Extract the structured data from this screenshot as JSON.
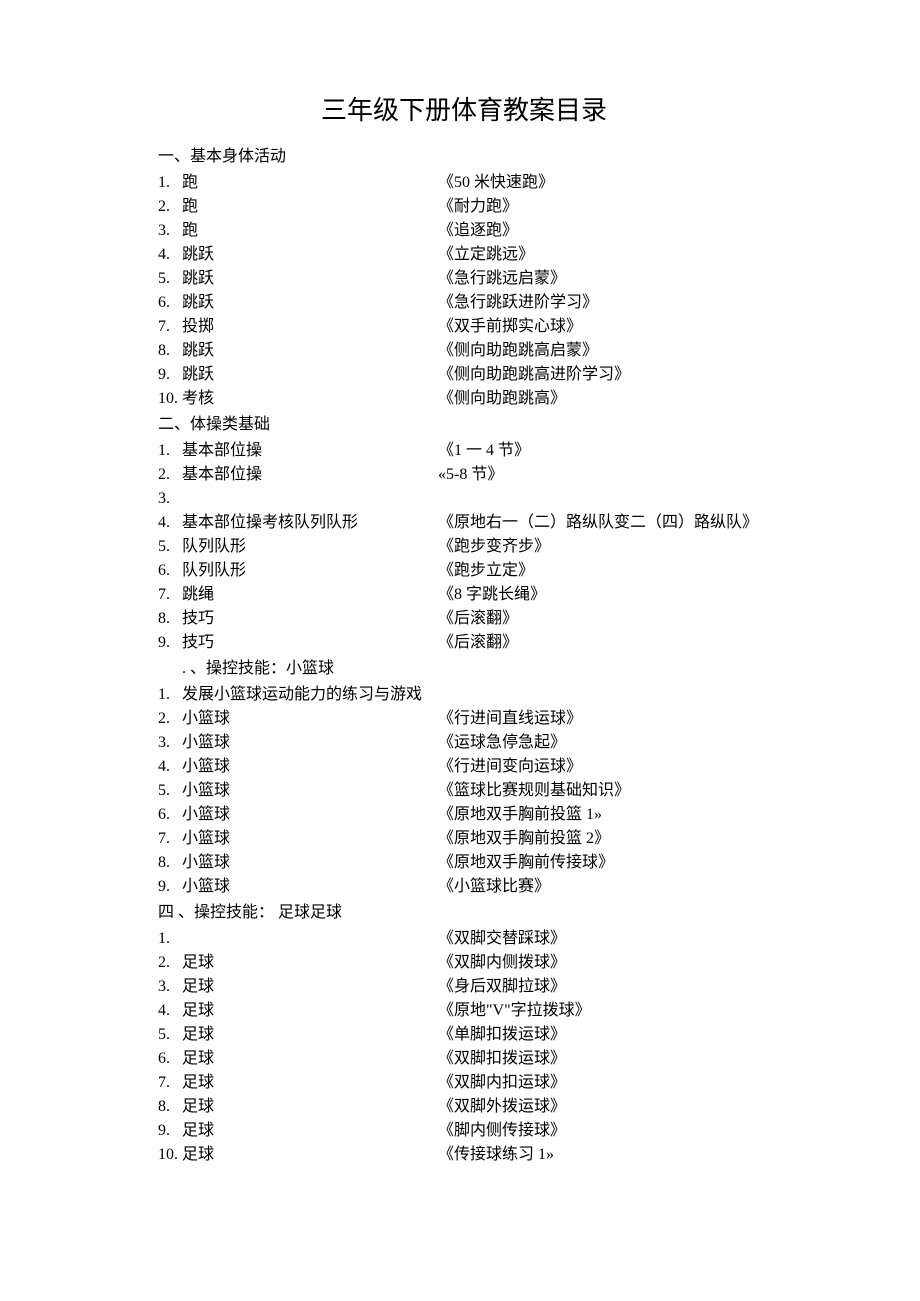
{
  "title": "三年级下册体育教案目录",
  "sections": [
    {
      "heading": "一、基本身体活动",
      "items": [
        {
          "num": "1.",
          "label": "跑",
          "desc": "《50 米快速跑》"
        },
        {
          "num": "2.",
          "label": "跑",
          "desc": "《耐力跑》"
        },
        {
          "num": "3.",
          "label": "跑",
          "desc": "《追逐跑》"
        },
        {
          "num": "4.",
          "label": "跳跃",
          "desc": "《立定跳远》"
        },
        {
          "num": "5.",
          "label": "跳跃",
          "desc": "《急行跳远启蒙》"
        },
        {
          "num": "6.",
          "label": "跳跃",
          "desc": "《急行跳跃进阶学习》"
        },
        {
          "num": "7.",
          "label": "投掷",
          "desc": "《双手前掷实心球》"
        },
        {
          "num": "8.",
          "label": "跳跃",
          "desc": "《侧向助跑跳高启蒙》"
        },
        {
          "num": "9.",
          "label": "跳跃",
          "desc": "《侧向助跑跳高进阶学习》"
        },
        {
          "num": "10.",
          "label": "考核",
          "desc": "《侧向助跑跳高》"
        }
      ]
    },
    {
      "heading": "二、体操类基础",
      "items": [
        {
          "num": "1.",
          "label": "基本部位操",
          "desc": "《1 一 4 节》"
        },
        {
          "num": "2.",
          "label": "基本部位操",
          "desc": "«5-8 节》"
        },
        {
          "num": "3.",
          "label": "",
          "desc": ""
        },
        {
          "num": "4.",
          "label": "基本部位操考核队列队形",
          "desc": "《原地右一（二）路纵队变二（四）路纵队》"
        },
        {
          "num": "5.",
          "label": "队列队形",
          "desc": "《跑步变齐步》"
        },
        {
          "num": "6.",
          "label": "队列队形",
          "desc": "《跑步立定》"
        },
        {
          "num": "7.",
          "label": "跳绳",
          "desc": "《8 字跳长绳》"
        },
        {
          "num": "8.",
          "label": "技巧",
          "desc": "《后滚翻》"
        },
        {
          "num": "9.",
          "label": "技巧",
          "desc": "《后滚翻》"
        }
      ]
    },
    {
      "heading": ". 、操控技能：小篮球",
      "heading_indent": true,
      "items": [
        {
          "num": "1.",
          "label": "发展小篮球运动能力的练习与游戏",
          "desc": ""
        },
        {
          "num": "2.",
          "label": "小篮球",
          "desc": "《行进间直线运球》"
        },
        {
          "num": "3.",
          "label": "小篮球",
          "desc": "《运球急停急起》"
        },
        {
          "num": "4.",
          "label": "小篮球",
          "desc": "《行进间变向运球》"
        },
        {
          "num": "5.",
          "label": "小篮球",
          "desc": "《篮球比赛规则基础知识》"
        },
        {
          "num": "6.",
          "label": "小篮球",
          "desc": "《原地双手胸前投篮 1»"
        },
        {
          "num": "7.",
          "label": "小篮球",
          "desc": "《原地双手胸前投篮 2》"
        },
        {
          "num": "8.",
          "label": "小篮球",
          "desc": "《原地双手胸前传接球》"
        },
        {
          "num": "9.",
          "label": "小篮球",
          "desc": "《小篮球比赛》"
        }
      ]
    },
    {
      "heading": "四 、操控技能： 足球足球",
      "items": [
        {
          "num": "1.",
          "label": "",
          "desc": "《双脚交替踩球》"
        },
        {
          "num": "2.",
          "label": "足球",
          "desc": "《双脚内侧拨球》"
        },
        {
          "num": "3.",
          "label": "足球",
          "desc": "《身后双脚拉球》"
        },
        {
          "num": "4.",
          "label": "足球",
          "desc": "《原地\"V\"字拉拨球》"
        },
        {
          "num": "5.",
          "label": "足球",
          "desc": "《单脚扣拨运球》"
        },
        {
          "num": "6.",
          "label": "足球",
          "desc": "《双脚扣拨运球》"
        },
        {
          "num": "7.",
          "label": "足球",
          "desc": "《双脚内扣运球》"
        },
        {
          "num": "8.",
          "label": "足球",
          "desc": "《双脚外拨运球》"
        },
        {
          "num": "9.",
          "label": "足球",
          "desc": "《脚内侧传接球》"
        },
        {
          "num": "10.",
          "label": "足球",
          "desc": "《传接球练习 1»"
        }
      ]
    }
  ]
}
